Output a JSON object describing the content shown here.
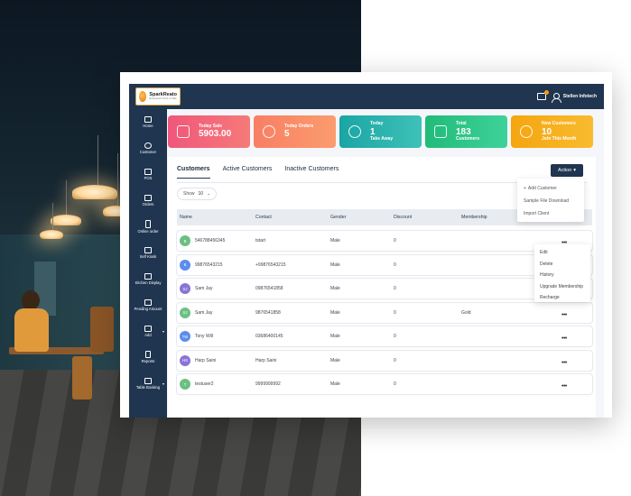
{
  "app": {
    "logo_name": "SparkReato",
    "logo_tagline": "Restaurant Point of Sale",
    "user_name": "Stellen Infotech"
  },
  "sidebar": {
    "items": [
      {
        "label": "Home",
        "icon": "home-icon"
      },
      {
        "label": "Customer",
        "icon": "customer-icon"
      },
      {
        "label": "POS",
        "icon": "pos-icon"
      },
      {
        "label": "Orders",
        "icon": "cart-icon"
      },
      {
        "label": "Online order",
        "icon": "mobile-icon"
      },
      {
        "label": "Self Kiosk",
        "icon": "kiosk-icon"
      },
      {
        "label": "Kitchen Display",
        "icon": "monitor-icon"
      },
      {
        "label": "Pending Amount",
        "icon": "card-icon"
      },
      {
        "label": "Add",
        "icon": "plus-icon"
      },
      {
        "label": "Reports",
        "icon": "report-icon"
      },
      {
        "label": "Table Booking",
        "icon": "edit-icon"
      }
    ]
  },
  "stats": [
    {
      "title": "Today Sale",
      "value": "5903.00",
      "sub": "",
      "icon": "bag-icon"
    },
    {
      "title": "Today Orders",
      "value": "5",
      "sub": "",
      "icon": "gear-icon"
    },
    {
      "title": "Today",
      "value": "1",
      "sub": "Take Away",
      "icon": "users-icon"
    },
    {
      "title": "Total",
      "value": "183",
      "sub": "Customers",
      "icon": "box-icon"
    },
    {
      "title": "New Customers",
      "value": "10",
      "sub": "Join This Month",
      "icon": "users-icon"
    }
  ],
  "tabs": [
    "Customers",
    "Active Customers",
    "Inactive Customers"
  ],
  "action": {
    "label": "Action",
    "menu": [
      "Add Customer",
      "Sample File Download",
      "Import Client"
    ]
  },
  "show": {
    "label": "Show",
    "value": "10"
  },
  "table": {
    "headers": [
      "Name",
      "Contact",
      "Gender",
      "Discount",
      "Membership"
    ],
    "rows": [
      {
        "initials": "B",
        "name": "546788456345",
        "contact": "tstart",
        "gender": "Male",
        "discount": "0",
        "membership": "",
        "color": "#6cbf84"
      },
      {
        "initials": "B",
        "name": "99876543215",
        "contact": "+99876543215",
        "gender": "Male",
        "discount": "0",
        "membership": "",
        "color": "#5b8def"
      },
      {
        "initials": "SJ",
        "name": "Sam Jay",
        "contact": "09876541858",
        "gender": "Male",
        "discount": "0",
        "membership": "",
        "color": "#8a74d6"
      },
      {
        "initials": "SJ",
        "name": "Sam Jay",
        "contact": "9876541858",
        "gender": "Male",
        "discount": "0",
        "membership": "Gold",
        "color": "#6cbf84"
      },
      {
        "initials": "TW",
        "name": "Tony Will",
        "contact": "03686400145",
        "gender": "Male",
        "discount": "0",
        "membership": "",
        "color": "#5b8def"
      },
      {
        "initials": "HS",
        "name": "Harp Saini",
        "contact": "Harp Saini",
        "gender": "Male",
        "discount": "0",
        "membership": "",
        "color": "#8a74d6"
      },
      {
        "initials": "T",
        "name": "testuser2",
        "contact": "9999999992",
        "gender": "Male",
        "discount": "0",
        "membership": "",
        "color": "#6cbf84"
      }
    ]
  },
  "row_menu": [
    "Edit",
    "Delete",
    "History",
    "Upgrade Membership",
    "Recharge"
  ]
}
